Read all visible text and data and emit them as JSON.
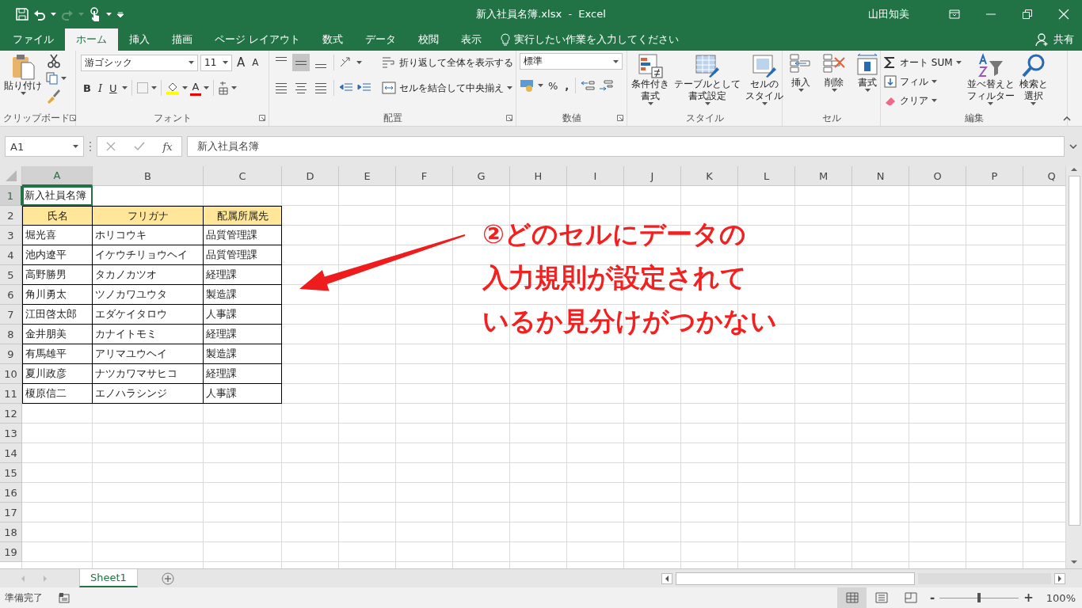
{
  "window": {
    "title": "新入社員名簿.xlsx  -  Excel",
    "user": "山田知美"
  },
  "tabs": [
    {
      "label": "ファイル",
      "selected": false
    },
    {
      "label": "ホーム",
      "selected": true
    },
    {
      "label": "挿入",
      "selected": false
    },
    {
      "label": "描画",
      "selected": false
    },
    {
      "label": "ページ レイアウト",
      "selected": false
    },
    {
      "label": "数式",
      "selected": false
    },
    {
      "label": "データ",
      "selected": false
    },
    {
      "label": "校閲",
      "selected": false
    },
    {
      "label": "表示",
      "selected": false
    }
  ],
  "tell_me": {
    "placeholder": "実行したい作業を入力してください"
  },
  "share": "共有",
  "ribbon": {
    "groups": [
      {
        "kind": "clipboard",
        "label": "クリップボード",
        "paste": "貼り付け"
      },
      {
        "kind": "font",
        "label": "フォント",
        "font_name": "游ゴシック",
        "font_size": "11",
        "grow": "A",
        "shrink": "A",
        "bold": "B",
        "italic": "I",
        "underline": "U",
        "font_color": "A"
      },
      {
        "kind": "alignment",
        "label": "配置",
        "align_buttons": [
          {
            "kind": "top",
            "selected": false
          },
          {
            "kind": "middle",
            "selected": true
          },
          {
            "kind": "bottom",
            "selected": false
          }
        ],
        "wrap_text": "折り返して全体を表示する",
        "merge_center": "セルを結合して中央揃え"
      },
      {
        "kind": "number",
        "label": "数値",
        "format": "標準",
        "percent": "%",
        "comma": ","
      },
      {
        "kind": "styles",
        "label": "スタイル",
        "buttons": [
          [
            "条件付き",
            "書式"
          ],
          [
            "テーブルとして",
            "書式設定"
          ],
          [
            "セルの",
            "スタイル"
          ]
        ]
      },
      {
        "kind": "cells",
        "label": "セル",
        "buttons": [
          "挿入",
          "削除",
          "書式"
        ]
      },
      {
        "kind": "editing",
        "label": "編集",
        "autosum": "オート SUM",
        "fill": "フィル",
        "clear": "クリア",
        "sort": [
          "並べ替えと",
          "フィルター"
        ],
        "find": [
          "検索と",
          "選択"
        ]
      }
    ]
  },
  "formula_bar": {
    "name_box": "A1",
    "fx": "fx",
    "value": "新入社員名簿"
  },
  "sheet": {
    "columns": [
      {
        "label": "A",
        "selected": true
      },
      {
        "label": "B",
        "selected": false
      },
      {
        "label": "C",
        "selected": false
      },
      {
        "label": "D",
        "selected": false
      },
      {
        "label": "E",
        "selected": false
      },
      {
        "label": "F",
        "selected": false
      },
      {
        "label": "G",
        "selected": false
      },
      {
        "label": "H",
        "selected": false
      },
      {
        "label": "I",
        "selected": false
      },
      {
        "label": "J",
        "selected": false
      },
      {
        "label": "K",
        "selected": false
      },
      {
        "label": "L",
        "selected": false
      },
      {
        "label": "M",
        "selected": false
      },
      {
        "label": "N",
        "selected": false
      },
      {
        "label": "O",
        "selected": false
      },
      {
        "label": "P",
        "selected": false
      },
      {
        "label": "Q",
        "selected": false
      }
    ],
    "rows": [
      {
        "label": "1",
        "kind": "title",
        "selected": true,
        "cells": [
          "新入社員名簿"
        ]
      },
      {
        "label": "2",
        "kind": "header",
        "selected": false,
        "cells": [
          "氏名",
          "フリガナ",
          "配属所属先"
        ]
      },
      {
        "label": "3",
        "kind": "data",
        "selected": false,
        "cells": [
          "堀光喜",
          "ホリコウキ",
          "品質管理課"
        ]
      },
      {
        "label": "4",
        "kind": "data",
        "selected": false,
        "cells": [
          "池内遼平",
          "イケウチリョウヘイ",
          "品質管理課"
        ]
      },
      {
        "label": "5",
        "kind": "data",
        "selected": false,
        "cells": [
          "高野勝男",
          "タカノカツオ",
          "経理課"
        ]
      },
      {
        "label": "6",
        "kind": "data",
        "selected": false,
        "cells": [
          "角川勇太",
          "ツノカワユウタ",
          "製造課"
        ]
      },
      {
        "label": "7",
        "kind": "data",
        "selected": false,
        "cells": [
          "江田啓太郎",
          "エダケイタロウ",
          "人事課"
        ]
      },
      {
        "label": "8",
        "kind": "data",
        "selected": false,
        "cells": [
          "金井朋美",
          "カナイトモミ",
          "経理課"
        ]
      },
      {
        "label": "9",
        "kind": "data",
        "selected": false,
        "cells": [
          "有馬雄平",
          "アリマユウヘイ",
          "製造課"
        ]
      },
      {
        "label": "10",
        "kind": "data",
        "selected": false,
        "cells": [
          "夏川政彦",
          "ナツカワマサヒコ",
          "経理課"
        ]
      },
      {
        "label": "11",
        "kind": "data",
        "selected": false,
        "cells": [
          "榎原信二",
          "エノハラシンジ",
          "人事課"
        ]
      },
      {
        "label": "12",
        "kind": "empty",
        "selected": false
      },
      {
        "label": "13",
        "kind": "empty",
        "selected": false
      },
      {
        "label": "14",
        "kind": "empty",
        "selected": false
      },
      {
        "label": "15",
        "kind": "empty",
        "selected": false
      },
      {
        "label": "16",
        "kind": "empty",
        "selected": false
      },
      {
        "label": "17",
        "kind": "empty",
        "selected": false
      },
      {
        "label": "18",
        "kind": "empty",
        "selected": false
      },
      {
        "label": "19",
        "kind": "empty",
        "selected": false
      }
    ]
  },
  "annotation": {
    "lines": [
      "②どのセルにデータの",
      "入力規則が設定されて",
      "いるか見分けがつかない"
    ]
  },
  "sheet_tabs": [
    {
      "label": "Sheet1",
      "selected": true
    }
  ],
  "status_bar": {
    "text": "準備完了",
    "views": [
      {
        "kind": "normal",
        "selected": true
      },
      {
        "kind": "page_layout",
        "selected": false
      },
      {
        "kind": "page_break",
        "selected": false
      }
    ],
    "zoom_out": "-",
    "zoom_in": "+",
    "zoom": {
      "level": 0.5,
      "label": "100%"
    }
  }
}
